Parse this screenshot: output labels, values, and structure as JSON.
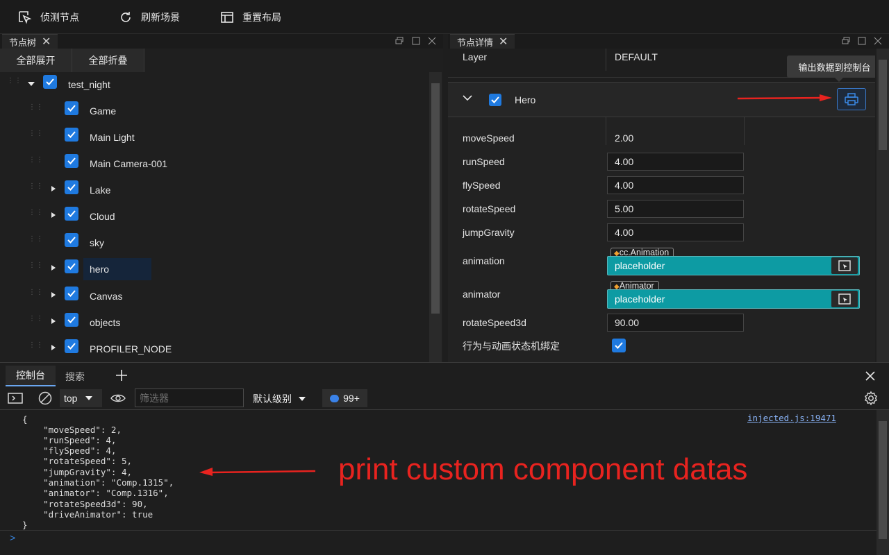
{
  "toolbar": {
    "detect_label": "侦测节点",
    "refresh_label": "刷新场景",
    "reset_label": "重置布局"
  },
  "tree_panel": {
    "tab_label": "节点树",
    "expand_all": "全部展开",
    "collapse_all": "全部折叠",
    "nodes": [
      {
        "label": "test_night",
        "expanded": true
      },
      {
        "label": "Game"
      },
      {
        "label": "Main Light"
      },
      {
        "label": "Main Camera-001"
      },
      {
        "label": "Lake",
        "has_children": true
      },
      {
        "label": "Cloud",
        "has_children": true
      },
      {
        "label": "sky"
      },
      {
        "label": "hero",
        "has_children": true,
        "selected": true
      },
      {
        "label": "Canvas",
        "has_children": true
      },
      {
        "label": "objects",
        "has_children": true
      },
      {
        "label": "PROFILER_NODE",
        "has_children": true
      }
    ]
  },
  "detail_panel": {
    "tab_label": "节点详情",
    "layer_label": "Layer",
    "layer_value": "DEFAULT",
    "tooltip": "输出数据到控制台",
    "component_name": "Hero",
    "props": [
      {
        "label": "moveSpeed",
        "value": "2.00"
      },
      {
        "label": "runSpeed",
        "value": "4.00"
      },
      {
        "label": "flySpeed",
        "value": "4.00"
      },
      {
        "label": "rotateSpeed",
        "value": "5.00"
      },
      {
        "label": "jumpGravity",
        "value": "4.00"
      }
    ],
    "animation": {
      "label": "animation",
      "tag": "cc.Animation",
      "value": "placeholder"
    },
    "animator": {
      "label": "animator",
      "tag": "Animator",
      "value": "placeholder"
    },
    "rotateSpeed3d": {
      "label": "rotateSpeed3d",
      "value": "90.00"
    },
    "drive_label": "行为与动画状态机绑定"
  },
  "console": {
    "tab_console": "控制台",
    "tab_search": "搜索",
    "context": "top",
    "filter_placeholder": "筛选器",
    "level": "默认级别",
    "badge": "99+",
    "source_link": "injected.js:19471",
    "lines": [
      "{",
      "    \"moveSpeed\": 2,",
      "    \"runSpeed\": 4,",
      "    \"flySpeed\": 4,",
      "    \"rotateSpeed\": 5,",
      "    \"jumpGravity\": 4,",
      "    \"animation\": \"Comp.1315\",",
      "    \"animator\": \"Comp.1316\",",
      "    \"rotateSpeed3d\": 90,",
      "    \"driveAnimator\": true",
      "}"
    ],
    "prompt": ">"
  },
  "annotation": {
    "text": "print custom component datas",
    "color": "#e8231f"
  },
  "colors": {
    "accent": "#1f7ae0",
    "object_field": "#0d9ba3"
  }
}
